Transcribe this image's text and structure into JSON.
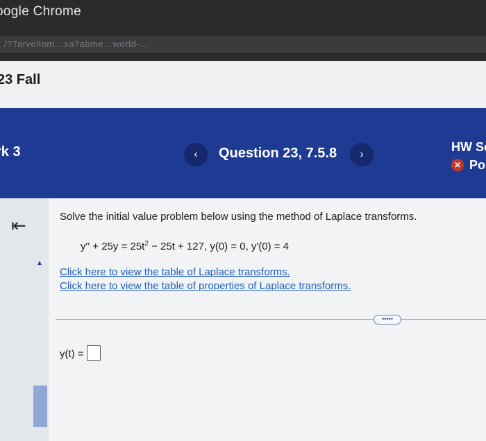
{
  "window": {
    "app_title": "oogle Chrome",
    "url": "/?TarvelIom…xa?abme…world-…"
  },
  "course": {
    "term": "23 Fall"
  },
  "nav": {
    "homework": "rk 3",
    "prev_symbol": "‹",
    "next_symbol": "›",
    "question_title": "Question 23, 7.5.8",
    "score_label": "HW Sc",
    "points_label": "Po",
    "points_icon": "✕"
  },
  "sidebar": {
    "collapse_symbol": "⇤",
    "scroll_up_symbol": "▲"
  },
  "question": {
    "prompt": "Solve the initial value problem below using the method of Laplace transforms.",
    "equation_part1": "y′′ + 25y = 25t",
    "equation_exp": "2",
    "equation_part2": " − 25t + 127, y(0) = 0, y′(0) = 4",
    "link_table": "Click here to view the table of Laplace transforms.",
    "link_properties": "Click here to view the table of properties of Laplace transforms.",
    "more_label": "•••••",
    "answer_label": "y(t) ="
  },
  "colors": {
    "nav_bg": "#1f3a93",
    "link": "#1f5fbf",
    "error": "#c0392b"
  }
}
